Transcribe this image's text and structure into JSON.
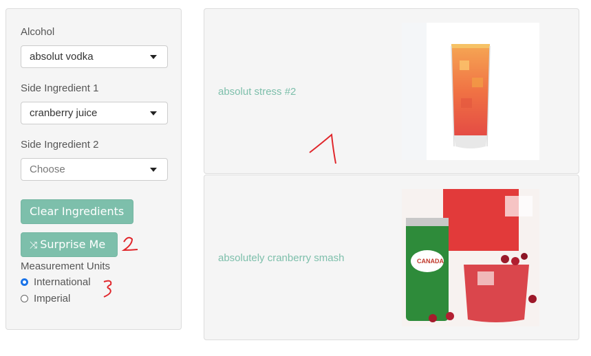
{
  "sidebar": {
    "alcohol": {
      "label": "Alcohol",
      "value": "absolut vodka"
    },
    "side1": {
      "label": "Side Ingredient 1",
      "value": "cranberry juice"
    },
    "side2": {
      "label": "Side Ingredient 2",
      "placeholder": "Choose"
    },
    "clear_label": "Clear Ingredients",
    "surprise_label": "Surprise Me",
    "units": {
      "label": "Measurement Units",
      "options": [
        "International",
        "Imperial"
      ],
      "selected": "International"
    }
  },
  "results": [
    {
      "title": "absolut stress #2"
    },
    {
      "title": "absolutely cranberry smash"
    }
  ],
  "colors": {
    "accent": "#7dbfab",
    "annotation": "#e0262b"
  }
}
